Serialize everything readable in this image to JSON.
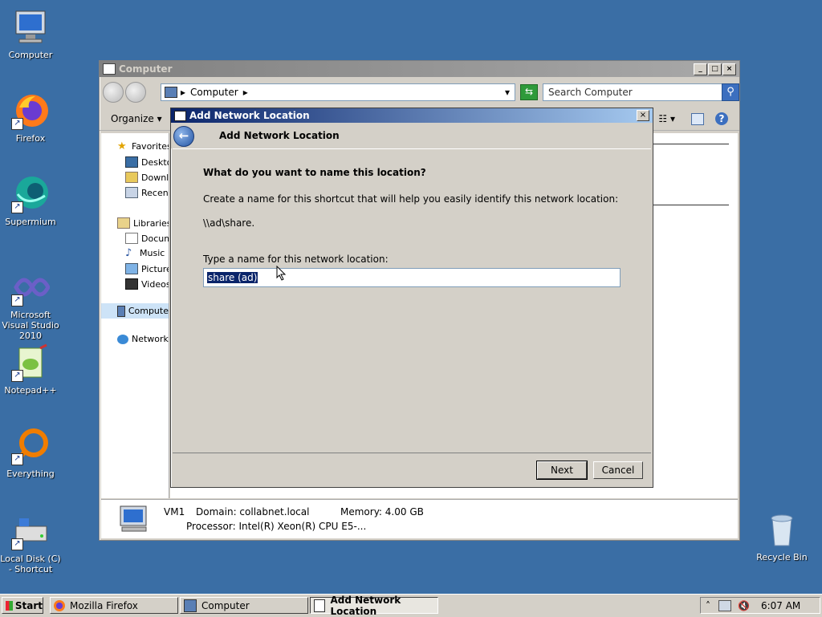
{
  "desktop": {
    "icons": [
      {
        "label": "Computer"
      },
      {
        "label": "Firefox"
      },
      {
        "label": "Supermium"
      },
      {
        "label": "Microsoft Visual Studio 2010"
      },
      {
        "label": "Notepad++"
      },
      {
        "label": "Everything"
      },
      {
        "label": "Local Disk (C) - Shortcut"
      },
      {
        "label": "Recycle Bin"
      }
    ]
  },
  "explorer": {
    "title": "Computer",
    "address": "Computer",
    "search_placeholder": "Search Computer",
    "toolbar": {
      "organize": "Organize"
    },
    "sidebar": [
      {
        "label": "Favorites"
      },
      {
        "label": "Deskto"
      },
      {
        "label": "Downlo"
      },
      {
        "label": "Recent"
      },
      {
        "label": "Libraries"
      },
      {
        "label": "Docum"
      },
      {
        "label": "Music"
      },
      {
        "label": "Picture"
      },
      {
        "label": "Videos"
      },
      {
        "label": "Compute"
      },
      {
        "label": "Network"
      }
    ],
    "details": {
      "name": "VM1",
      "domain": "Domain: collabnet.local",
      "memory": "Memory: 4.00 GB",
      "processor": "Processor: Intel(R) Xeon(R) CPU E5-..."
    }
  },
  "dialog": {
    "title": "Add Network Location",
    "header": "Add Network Location",
    "question": "What do you want to name this location?",
    "description": "Create a name for this shortcut that will help you easily identify this network location:",
    "path": "\\\\ad\\share.",
    "field_label": "Type a name for this network location:",
    "field_value": "share (ad)",
    "next": "Next",
    "cancel": "Cancel"
  },
  "taskbar": {
    "start": "Start",
    "tasks": [
      {
        "label": "Mozilla Firefox"
      },
      {
        "label": "Computer"
      },
      {
        "label": "Add Network Location"
      }
    ],
    "clock": "6:07 AM"
  }
}
